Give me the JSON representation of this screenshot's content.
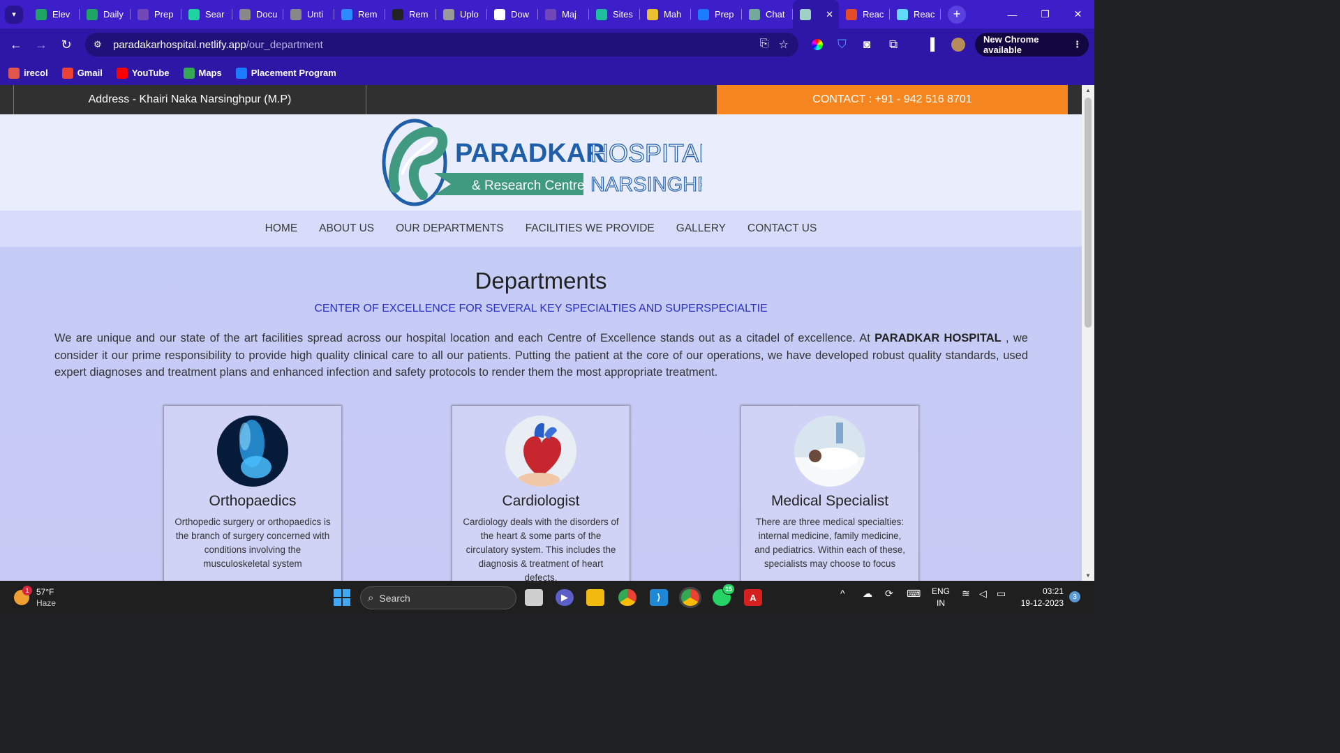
{
  "browser": {
    "tabs": [
      {
        "label": "Elev",
        "icon": "sheets-icon",
        "color": "#1fa463"
      },
      {
        "label": "Daily",
        "icon": "sheets-icon",
        "color": "#1fa463"
      },
      {
        "label": "Prep",
        "icon": "forms-icon",
        "color": "#7248b9"
      },
      {
        "label": "Sear",
        "icon": "vercel-v-icon",
        "color": "#1fd4a0"
      },
      {
        "label": "Docu",
        "icon": "globe-icon",
        "color": "#888888"
      },
      {
        "label": "Unti",
        "icon": "globe-icon",
        "color": "#888888"
      },
      {
        "label": "Rem",
        "icon": "edit-icon",
        "color": "#2b8cff"
      },
      {
        "label": "Rem",
        "icon": "github-icon",
        "color": "#222222"
      },
      {
        "label": "Uplo",
        "icon": "layers-icon",
        "color": "#999999"
      },
      {
        "label": "Dow",
        "icon": "download-icon",
        "color": "#ffffff"
      },
      {
        "label": "Maj",
        "icon": "forms-icon",
        "color": "#7248b9"
      },
      {
        "label": "Sites",
        "icon": "diamond-icon",
        "color": "#1fbf9e"
      },
      {
        "label": "Mah",
        "icon": "smile-icon",
        "color": "#e8c030"
      },
      {
        "label": "Prep",
        "icon": "pb-icon",
        "color": "#1b7cff"
      },
      {
        "label": "Chat",
        "icon": "chatgpt-icon",
        "color": "#74aa9c"
      },
      {
        "label": "",
        "icon": "hospital-icon",
        "color": "#9fd0c8",
        "active": true
      },
      {
        "label": "Reac",
        "icon": "react-icon",
        "color": "#e34c26"
      },
      {
        "label": "Reac",
        "icon": "react-icon",
        "color": "#61dafb"
      }
    ],
    "url_host": "paradakarhospital.netlify.app",
    "url_path": "/our_department",
    "new_chrome": "New Chrome available",
    "bookmarks": [
      {
        "label": "irecol",
        "icon": "irecol-icon",
        "color": "#e2574c"
      },
      {
        "label": "Gmail",
        "icon": "gmail-icon",
        "color": "#ea4335"
      },
      {
        "label": "YouTube",
        "icon": "youtube-icon",
        "color": "#ff0000"
      },
      {
        "label": "Maps",
        "icon": "maps-icon",
        "color": "#34a853"
      },
      {
        "label": "Placement Program",
        "icon": "pb-icon",
        "color": "#1b7cff"
      }
    ]
  },
  "site": {
    "address": "Address - Khairi Naka Narsinghpur (M.P)",
    "contact": "CONTACT : +91 - 942 516 8701",
    "logo": {
      "brand": "PARADKAR",
      "word2": "HOSPITAL",
      "tagline": "& Research Centre",
      "city": "NARSINGHPUR"
    },
    "nav": [
      "HOME",
      "ABOUT US",
      "OUR DEPARTMENTS",
      "FACILITIES WE PROVIDE",
      "GALLERY",
      "CONTACT US"
    ],
    "heading": "Departments",
    "subtitle": "CENTER OF EXCELLENCE FOR SEVERAL KEY SPECIALTIES AND SUPERSPECIALTIE",
    "intro_a": "We are unique and our state of the art facilities spread across our hospital location and each Centre of Excellence stands out as a citadel of excellence. At ",
    "intro_bold": "PARADKAR HOSPITAL",
    "intro_b": " , we consider it our prime responsibility to provide high quality clinical care to all our patients. Putting the patient at the core of our operations, we have developed robust quality standards, used expert diagnoses and treatment plans and enhanced infection and safety protocols to render them the most appropriate treatment.",
    "cards": [
      {
        "title": "Orthopaedics",
        "desc": "Orthopedic surgery or orthopaedics is the branch of surgery concerned with conditions involving the musculoskeletal system",
        "image": "knee-xray-image"
      },
      {
        "title": "Cardiologist",
        "desc": "Cardiology deals with the disorders of the heart & some parts of the circulatory system. This includes the diagnosis & treatment of heart defects.",
        "image": "heart-model-image"
      },
      {
        "title": "Medical Specialist",
        "desc": "There are three medical specialties: internal medicine, family medicine, and pediatrics. Within each of these, specialists may choose to focus",
        "image": "patient-bed-image"
      }
    ],
    "colors": {
      "topbar": "#303030",
      "contact_bg": "#f5861f",
      "subtitle": "#2a2fc4",
      "logo_teal": "#3f9a7f",
      "logo_blue": "#1f5ea8"
    }
  },
  "taskbar": {
    "temp": "57°F",
    "condition": "Haze",
    "weather_badge": "1",
    "search_placeholder": "Search",
    "whatsapp_badge": "15",
    "lang1": "ENG",
    "lang2": "IN",
    "time": "03:21",
    "date": "19-12-2023",
    "notif_count": "3"
  }
}
